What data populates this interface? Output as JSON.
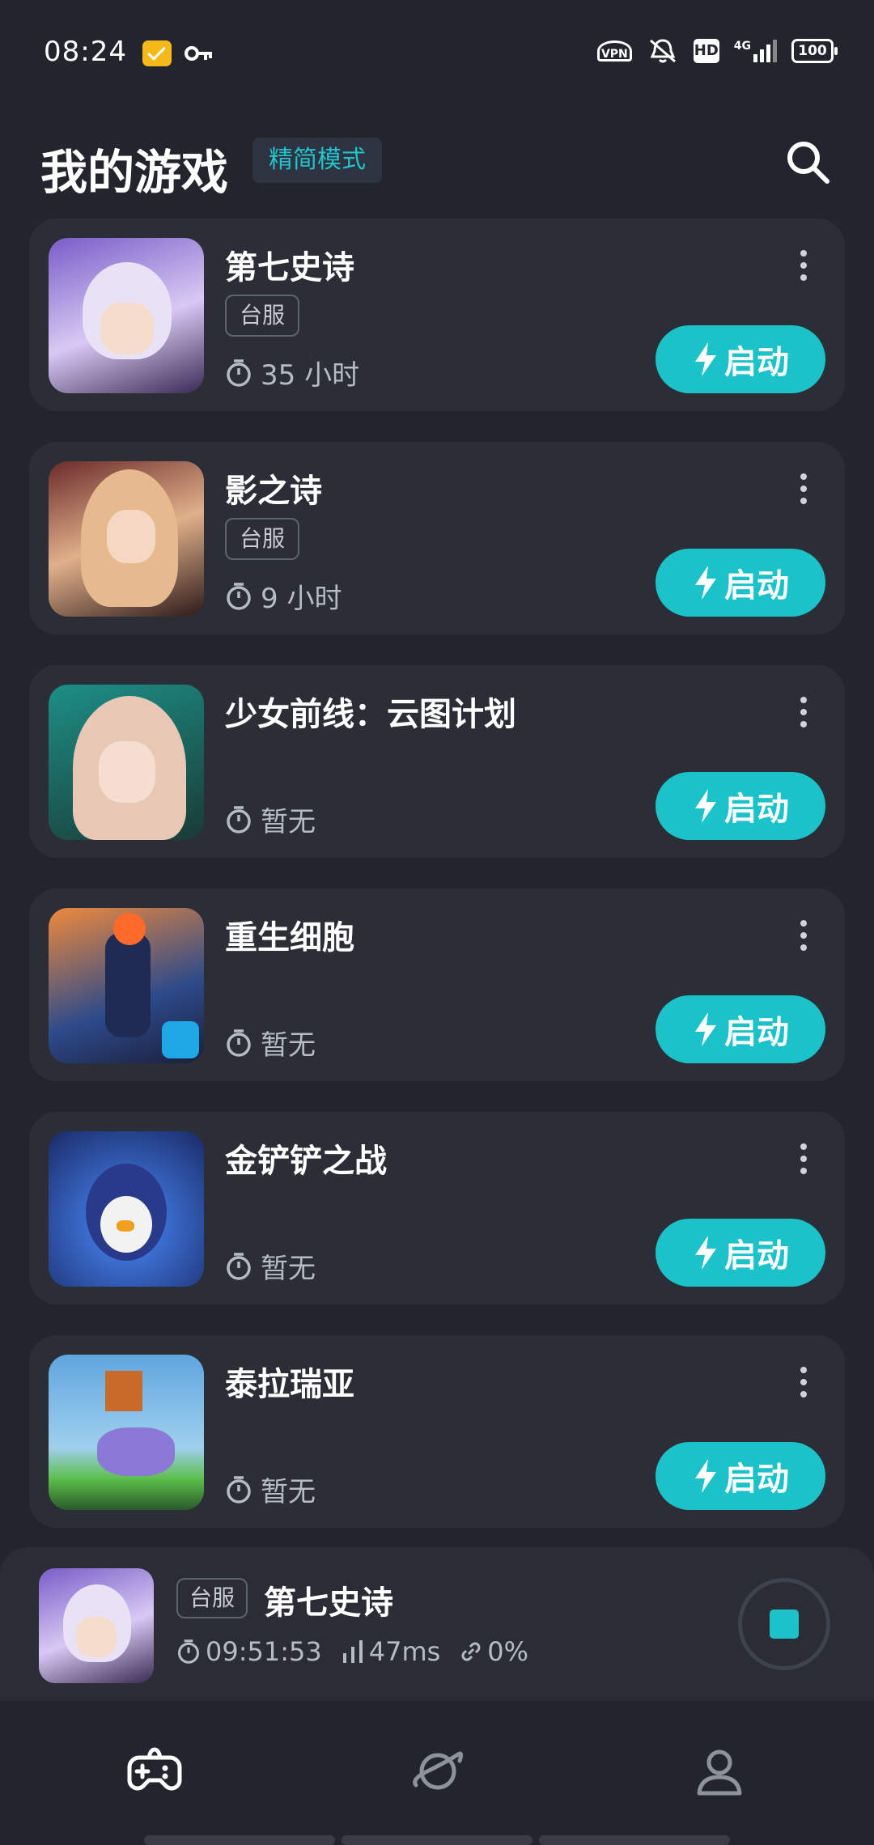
{
  "status_bar": {
    "time": "08:24",
    "vpn_label": "VPN",
    "hd_label": "HD",
    "network_label": "4G",
    "battery": "100"
  },
  "header": {
    "title": "我的游戏",
    "mode_chip": "精简模式"
  },
  "games": [
    {
      "name": "第七史诗",
      "tag": "台服",
      "playtime": "35 小时",
      "launch": "启动",
      "cover_colors": [
        "#7a5cc9",
        "#d7c9f3",
        "#3a2a55"
      ]
    },
    {
      "name": "影之诗",
      "tag": "台服",
      "playtime": "9 小时",
      "launch": "启动",
      "cover_colors": [
        "#6b2b2b",
        "#e0b08a",
        "#2d1a1a"
      ]
    },
    {
      "name": "少女前线：云图计划",
      "tag": "",
      "playtime": "暂无",
      "launch": "启动",
      "cover_colors": [
        "#1c8f86",
        "#e8c7b5",
        "#1a3a36"
      ]
    },
    {
      "name": "重生细胞",
      "tag": "",
      "playtime": "暂无",
      "launch": "启动",
      "cover_colors": [
        "#f08a3c",
        "#2d4a8a",
        "#1a1f3a"
      ]
    },
    {
      "name": "金铲铲之战",
      "tag": "",
      "playtime": "暂无",
      "launch": "启动",
      "cover_colors": [
        "#2a5bd6",
        "#f2f2f2",
        "#1a2a66"
      ]
    },
    {
      "name": "泰拉瑞亚",
      "tag": "",
      "playtime": "暂无",
      "launch": "启动",
      "cover_colors": [
        "#5fa6de",
        "#5cbf4a",
        "#2a5a2a"
      ]
    }
  ],
  "now_playing": {
    "tag": "台服",
    "name": "第七史诗",
    "session_time": "09:51:53",
    "latency": "47ms",
    "packet_loss": "0%"
  },
  "colors": {
    "background": "#22252d",
    "card": "#2b2e37",
    "accent": "#1cc2c9"
  },
  "bottom_nav": [
    {
      "icon": "gamepad-icon",
      "active": true
    },
    {
      "icon": "planet-icon",
      "active": false
    },
    {
      "icon": "profile-icon",
      "active": false
    }
  ]
}
